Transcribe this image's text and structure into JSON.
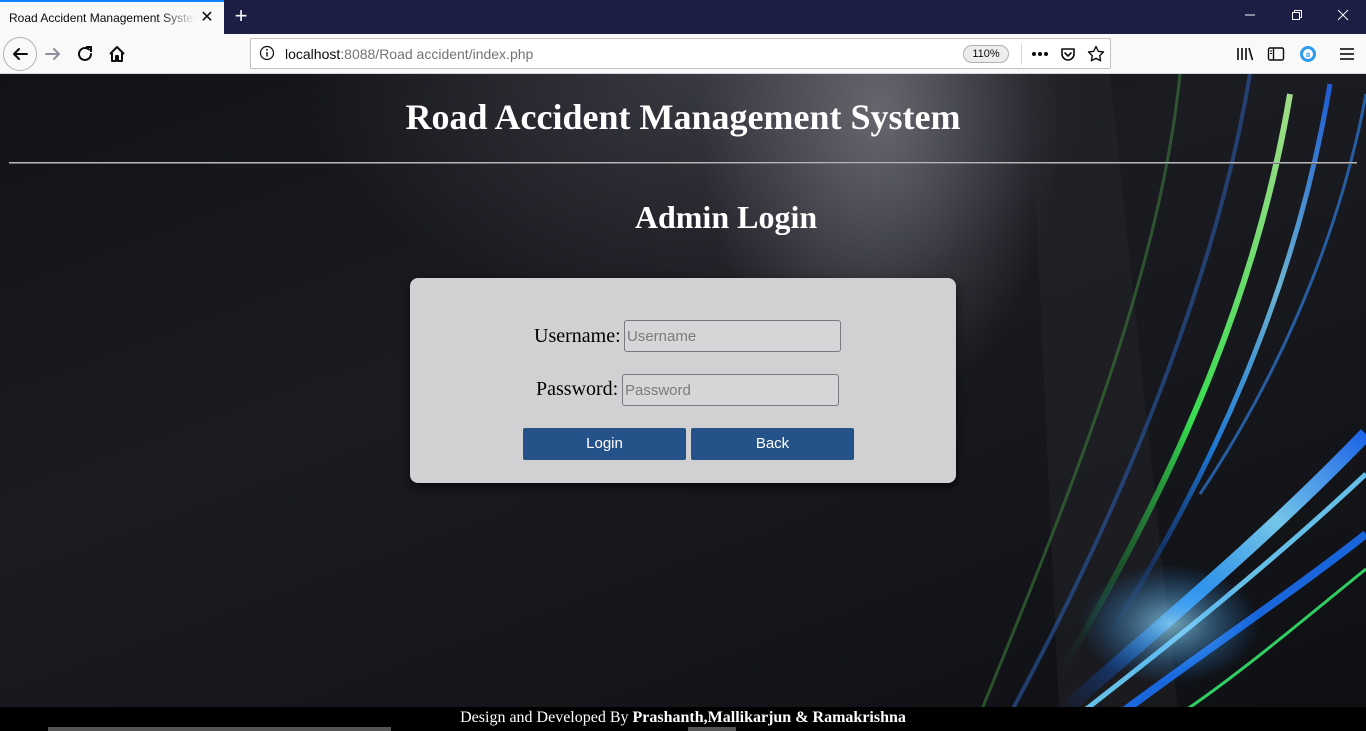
{
  "browser": {
    "tab_title": "Road Accident Management System",
    "tab_close_icon": "close-icon",
    "new_tab_icon": "plus-icon",
    "window_controls": [
      "minimize-icon",
      "restore-icon",
      "close-icon"
    ],
    "url_host": "localhost",
    "url_rest": ":8088/Road accident/index.php",
    "zoom": "110%",
    "toolbar_icons": [
      "library-icon",
      "sidebar-icon",
      "extension-icon",
      "menu-icon"
    ]
  },
  "page": {
    "title": "Road Accident Management System",
    "login_heading": "Admin Login",
    "username_label": "Username:",
    "username_placeholder": "Username",
    "password_label": "Password:",
    "password_placeholder": "Password",
    "login_button": "Login",
    "back_button": "Back",
    "footer_prefix": "Design and Developed By ",
    "footer_names": "Prashanth,Mallikarjun & Ramakrishna"
  },
  "colors": {
    "tabbar": "#1c1f43",
    "accent": "#0a84ff",
    "button": "#255389",
    "card": "#d1d1d3"
  }
}
